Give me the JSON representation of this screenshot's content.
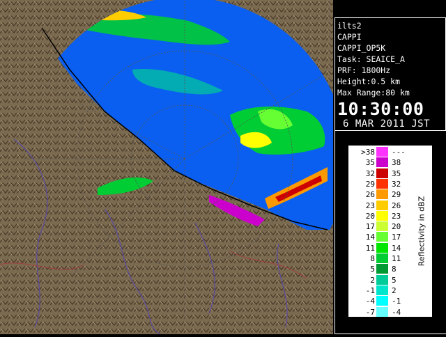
{
  "info": {
    "station": "ilts2",
    "product": "CAPPI",
    "product_name": "CAPPI_OP5K",
    "task": "Task: SEAICE_A",
    "prf": "PRF: 1800Hz",
    "height": "Height:0.5 km",
    "max_range": "Max Range:80 km",
    "time": "10:30:00",
    "date": "6 MAR 2011 JST"
  },
  "legend": {
    "unit": "Reflectivity in dBZ",
    "rows": [
      {
        "lo": ">38",
        "hi": "---",
        "color": "#ff33ff"
      },
      {
        "lo": "35",
        "hi": "38",
        "color": "#cc00cc"
      },
      {
        "lo": "32",
        "hi": "35",
        "color": "#cc0000"
      },
      {
        "lo": "29",
        "hi": "32",
        "color": "#ff3300"
      },
      {
        "lo": "26",
        "hi": "29",
        "color": "#ff9900"
      },
      {
        "lo": "23",
        "hi": "26",
        "color": "#ffcc00"
      },
      {
        "lo": "20",
        "hi": "23",
        "color": "#ffff00"
      },
      {
        "lo": "17",
        "hi": "20",
        "color": "#ccff33"
      },
      {
        "lo": "14",
        "hi": "17",
        "color": "#66ff33"
      },
      {
        "lo": "11",
        "hi": "14",
        "color": "#00e600"
      },
      {
        "lo": "8",
        "hi": "11",
        "color": "#00cc33"
      },
      {
        "lo": "5",
        "hi": "8",
        "color": "#009933"
      },
      {
        "lo": "2",
        "hi": "5",
        "color": "#00cc99"
      },
      {
        "lo": "-1",
        "hi": "2",
        "color": "#00e6cc"
      },
      {
        "lo": "-4",
        "hi": "-1",
        "color": "#00ffff"
      },
      {
        "lo": "-7",
        "hi": "-4",
        "color": "#66ffff"
      }
    ]
  },
  "colors": {
    "sea": "#0a5ff0",
    "land": "#7a6a50",
    "background": "#000000"
  },
  "icons": {
    "radar": "radar-cappi-map"
  }
}
